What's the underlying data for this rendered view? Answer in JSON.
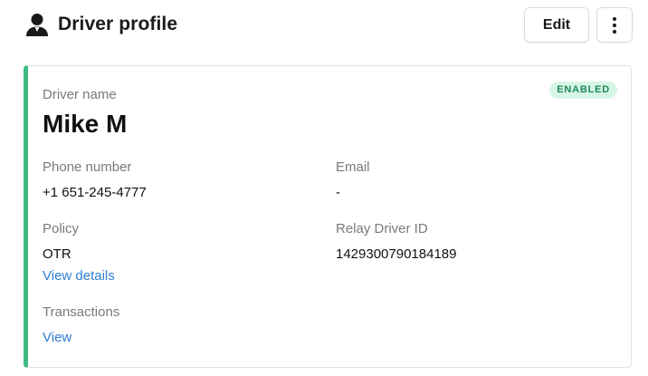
{
  "header": {
    "title": "Driver profile",
    "edit_label": "Edit",
    "title_icon": "person-icon",
    "more_icon": "more-vertical-icon"
  },
  "card": {
    "accent_color": "#3dbb80",
    "status": "ENABLED",
    "driver_name_label": "Driver name",
    "driver_name": "Mike M",
    "phone_label": "Phone number",
    "phone": "+1 651-245-4777",
    "email_label": "Email",
    "email": "-",
    "policy_label": "Policy",
    "policy": "OTR",
    "policy_link": "View details",
    "relay_id_label": "Relay Driver ID",
    "relay_id": "1429300790184189",
    "transactions_label": "Transactions",
    "transactions_link": "View"
  }
}
